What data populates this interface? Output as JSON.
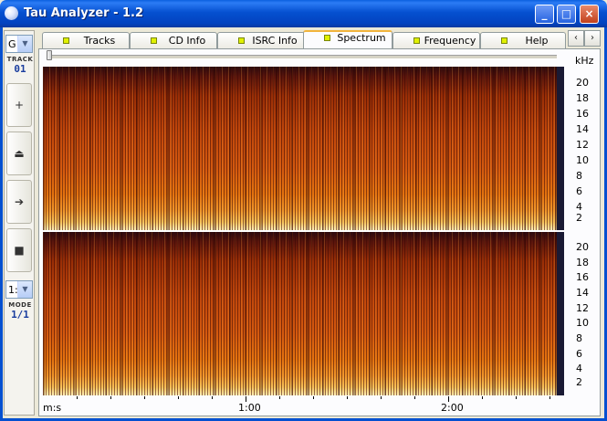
{
  "window": {
    "title": "Tau Analyzer - 1.2",
    "minimize_glyph": "_",
    "maximize_glyph": "□",
    "close_glyph": "×"
  },
  "sidebar": {
    "drive_value": "G",
    "track_caption": "TRACK",
    "track_value": "01",
    "mode_select_value": "1:",
    "mode_caption": "MODE",
    "mode_value": "1/1",
    "buttons": [
      {
        "icon": "plus-icon",
        "glyph": "+"
      },
      {
        "icon": "eject-icon",
        "glyph": "⏏"
      },
      {
        "icon": "arrow-right-icon",
        "glyph": "➔"
      },
      {
        "icon": "stop-icon",
        "glyph": "■"
      }
    ]
  },
  "tabs": [
    {
      "label": "Tracks",
      "active": false
    },
    {
      "label": "CD Info",
      "active": false
    },
    {
      "label": "ISRC Info",
      "active": false
    },
    {
      "label": "Spectrum",
      "active": true
    },
    {
      "label": "Frequency",
      "active": false
    },
    {
      "label": "Help",
      "active": false
    }
  ],
  "tab_scroll": {
    "left": "‹",
    "right": "›"
  },
  "spectrum": {
    "unit_label": "kHz",
    "freq_ticks": [
      "20",
      "18",
      "16",
      "14",
      "12",
      "10",
      "8",
      "6",
      "4",
      "2"
    ],
    "time_unit_label": "m:s",
    "time_labels": [
      "1:00",
      "2:00"
    ],
    "colors": {
      "low": "#2a0a10",
      "mid": "#d4590f",
      "high": "#fff0b8"
    }
  }
}
